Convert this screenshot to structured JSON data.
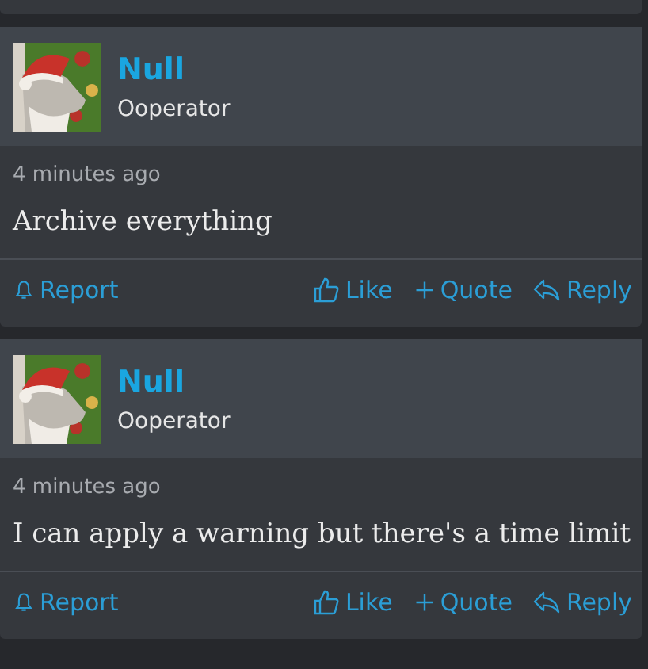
{
  "posts": [
    {
      "author": "Null",
      "role": "Ooperator",
      "time": "4 minutes ago",
      "content": "Archive everything",
      "actions": {
        "report": "Report",
        "like": "Like",
        "quote": "Quote",
        "reply": "Reply"
      }
    },
    {
      "author": "Null",
      "role": "Ooperator",
      "time": "4 minutes ago",
      "content": "I can apply a warning but there's a time limit",
      "actions": {
        "report": "Report",
        "like": "Like",
        "quote": "Quote",
        "reply": "Reply"
      }
    }
  ]
}
